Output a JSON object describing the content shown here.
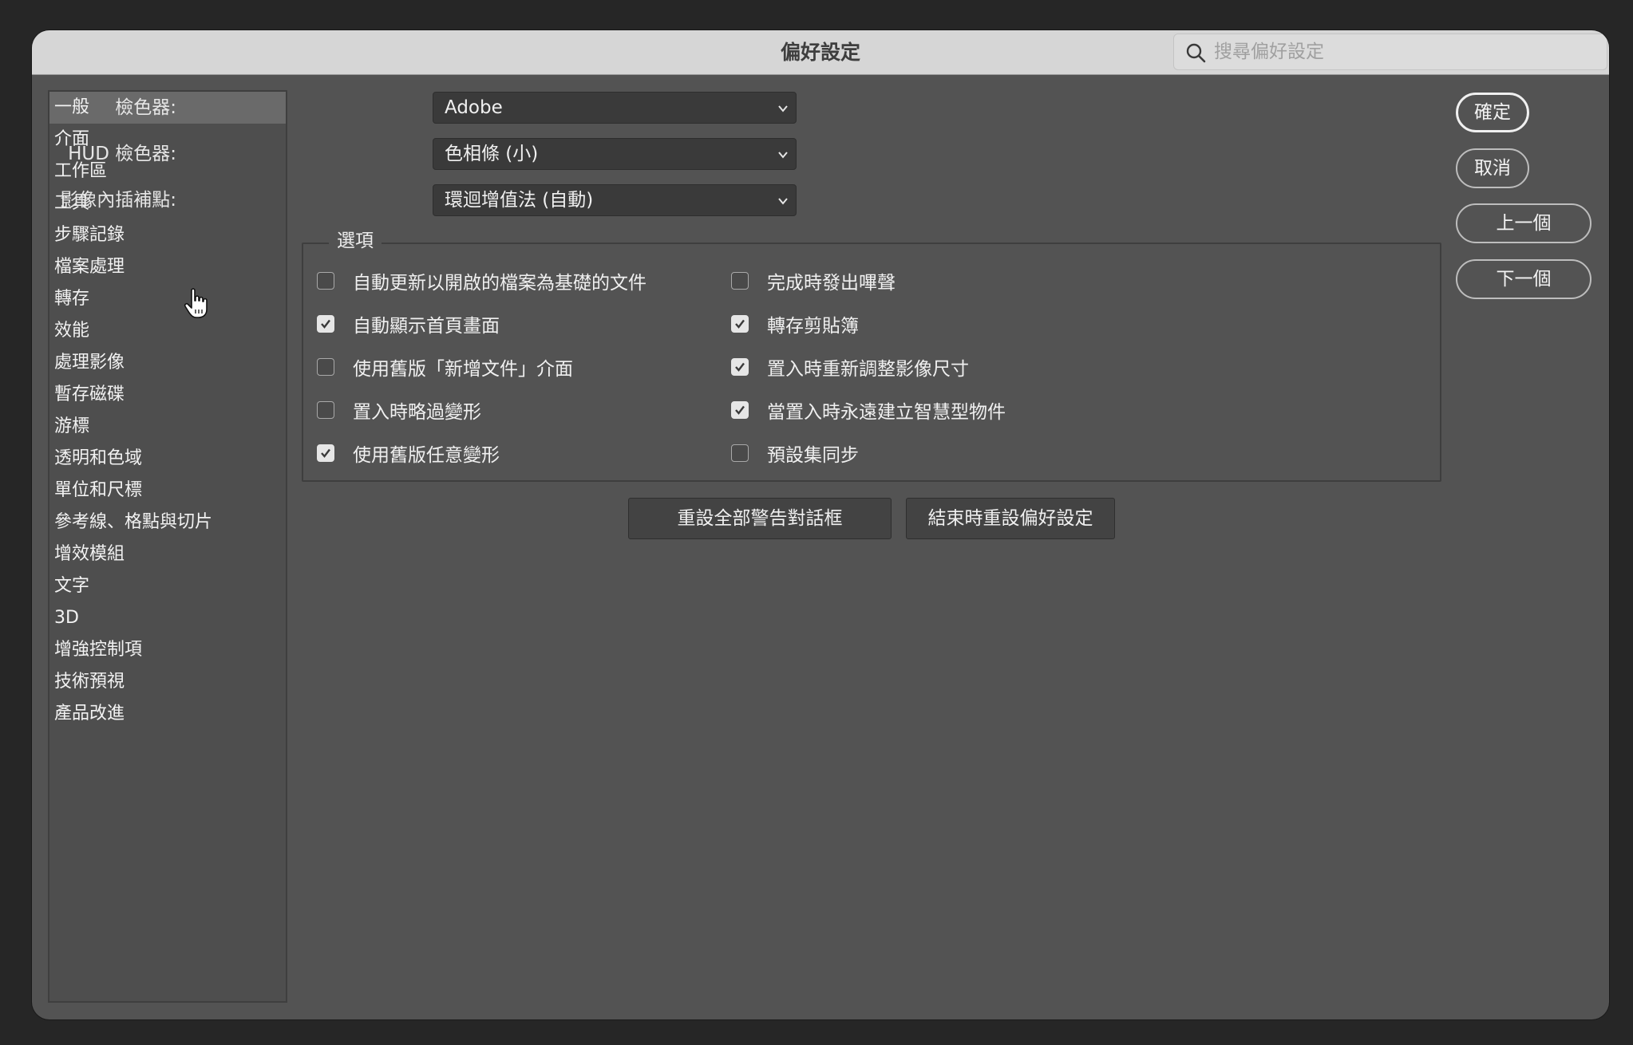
{
  "window": {
    "title": "偏好設定"
  },
  "search": {
    "placeholder": "搜尋偏好設定"
  },
  "sidebar": {
    "items": [
      {
        "label": "一般",
        "selected": true
      },
      {
        "label": "介面"
      },
      {
        "label": "工作區"
      },
      {
        "label": "工具"
      },
      {
        "label": "步驟記錄"
      },
      {
        "label": "檔案處理"
      },
      {
        "label": "轉存"
      },
      {
        "label": "效能"
      },
      {
        "label": "處理影像"
      },
      {
        "label": "暫存磁碟"
      },
      {
        "label": "游標"
      },
      {
        "label": "透明和色域"
      },
      {
        "label": "單位和尺標"
      },
      {
        "label": "參考線、格點與切片"
      },
      {
        "label": "增效模組"
      },
      {
        "label": "文字"
      },
      {
        "label": "3D"
      },
      {
        "label": "增強控制項"
      },
      {
        "label": "技術預視"
      },
      {
        "label": "產品改進"
      }
    ]
  },
  "fields": {
    "color_picker": {
      "label": "檢色器:",
      "value": "Adobe"
    },
    "hud_color_picker": {
      "label": "HUD 檢色器:",
      "value": "色相條 (小)"
    },
    "image_interpolation": {
      "label": "影像內插補點:",
      "value": "環迴增值法 (自動)"
    }
  },
  "options": {
    "title": "選項",
    "left": [
      {
        "label": "自動更新以開啟的檔案為基礎的文件",
        "checked": false
      },
      {
        "label": "自動顯示首頁畫面",
        "checked": true
      },
      {
        "label": "使用舊版「新增文件」介面",
        "checked": false
      },
      {
        "label": "置入時略過變形",
        "checked": false
      },
      {
        "label": "使用舊版任意變形",
        "checked": true
      }
    ],
    "right": [
      {
        "label": "完成時發出嗶聲",
        "checked": false
      },
      {
        "label": "轉存剪貼簿",
        "checked": true
      },
      {
        "label": "置入時重新調整影像尺寸",
        "checked": true
      },
      {
        "label": "當置入時永遠建立智慧型物件",
        "checked": true
      },
      {
        "label": "預設集同步",
        "checked": false
      }
    ]
  },
  "buttons": {
    "reset_warnings": "重設全部警告對話框",
    "reset_on_quit": "結束時重設偏好設定",
    "ok": "確定",
    "cancel": "取消",
    "prev": "上一個",
    "next": "下一個"
  }
}
